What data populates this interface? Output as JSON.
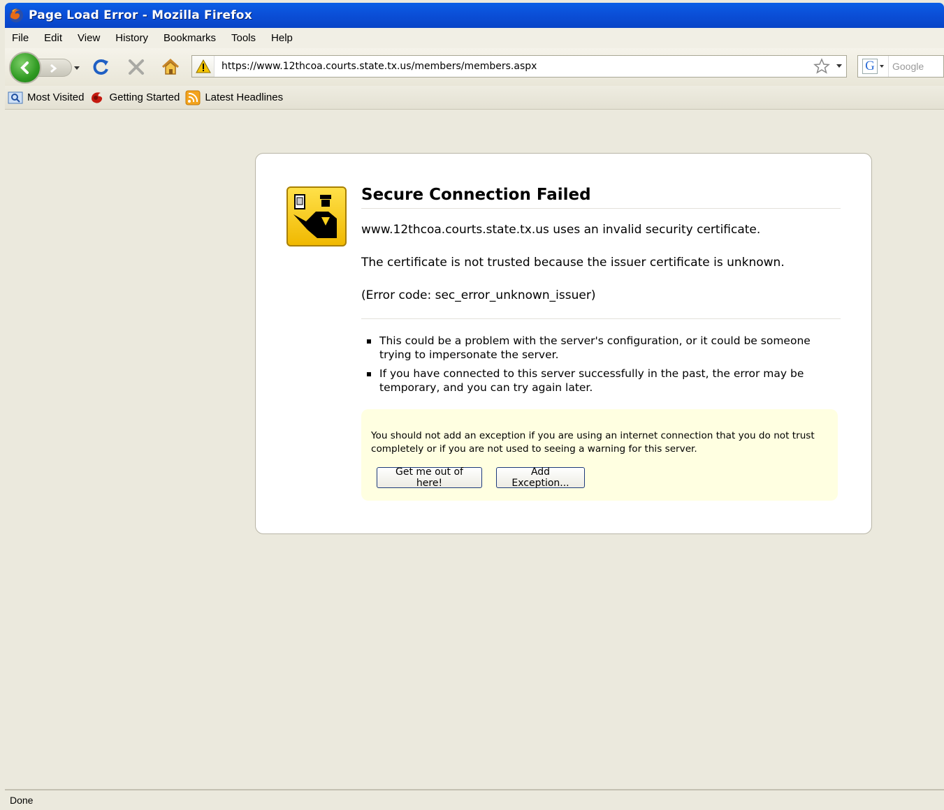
{
  "window": {
    "title": "Page Load Error - Mozilla Firefox"
  },
  "menu": [
    "File",
    "Edit",
    "View",
    "History",
    "Bookmarks",
    "Tools",
    "Help"
  ],
  "navbar": {
    "url": "https://www.12thcoa.courts.state.tx.us/members/members.aspx",
    "search_placeholder": "Google"
  },
  "bookmarks": [
    {
      "label": "Most Visited",
      "icon": "most-visited-icon"
    },
    {
      "label": "Getting Started",
      "icon": "firefox-getting-started-icon"
    },
    {
      "label": "Latest Headlines",
      "icon": "rss-feed-icon"
    }
  ],
  "error": {
    "title": "Secure Connection Failed",
    "line1": "www.12thcoa.courts.state.tx.us uses an invalid security certificate.",
    "line2": "The certificate is not trusted because the issuer certificate is unknown.",
    "line3": "(Error code: sec_error_unknown_issuer)",
    "bullets": [
      "This could be a problem with the server's configuration, or it could be someone trying to impersonate the server.",
      "If you have connected to this server successfully in the past, the error may be temporary, and you can try again later."
    ],
    "warning": "You should not add an exception if you are using an internet connection that you do not trust completely or if you are not used to seeing a warning for this server.",
    "button_leave": "Get me out of here!",
    "button_exception": "Add Exception..."
  },
  "status": "Done"
}
